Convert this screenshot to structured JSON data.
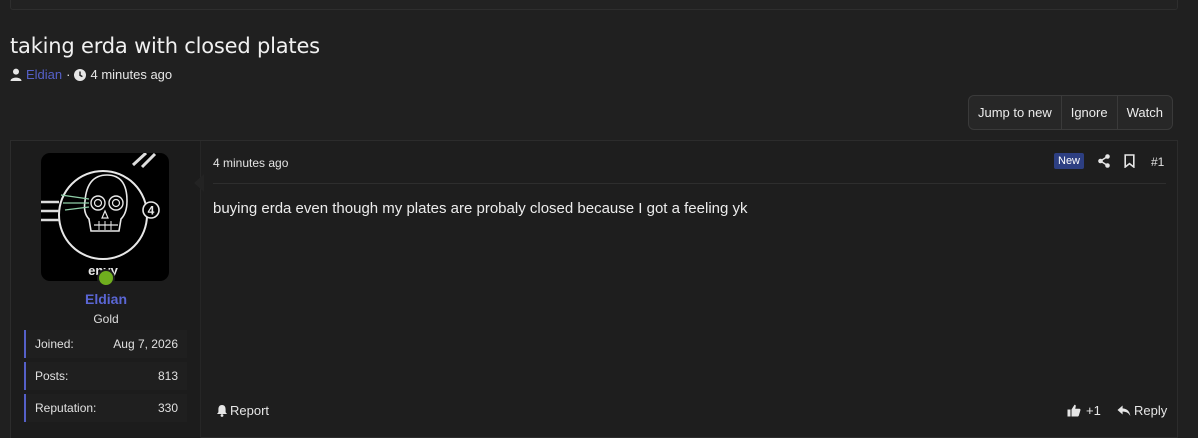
{
  "thread": {
    "title": "taking erda with closed plates",
    "author": "Eldian",
    "separator": "·",
    "time": "4 minutes ago"
  },
  "actions": {
    "jump_to_new": "Jump to new",
    "ignore": "Ignore",
    "watch": "Watch"
  },
  "post": {
    "time": "4 minutes ago",
    "badge": "New",
    "number": "#1",
    "body": "buying erda even though my plates are probaly closed because I got a feeling yk",
    "report_label": "Report",
    "like_count": "+1",
    "reply_label": "Reply"
  },
  "user": {
    "name": "Eldian",
    "title": "Gold",
    "avatar_text": "envy",
    "avatar_badge": "4",
    "online_color": "#6fae1e",
    "stats": [
      {
        "label": "Joined:",
        "value": "Aug 7, 2026"
      },
      {
        "label": "Posts:",
        "value": "813"
      },
      {
        "label": "Reputation:",
        "value": "330"
      }
    ]
  },
  "colors": {
    "accent": "#5560c8",
    "badge_bg": "#2d3f82"
  }
}
